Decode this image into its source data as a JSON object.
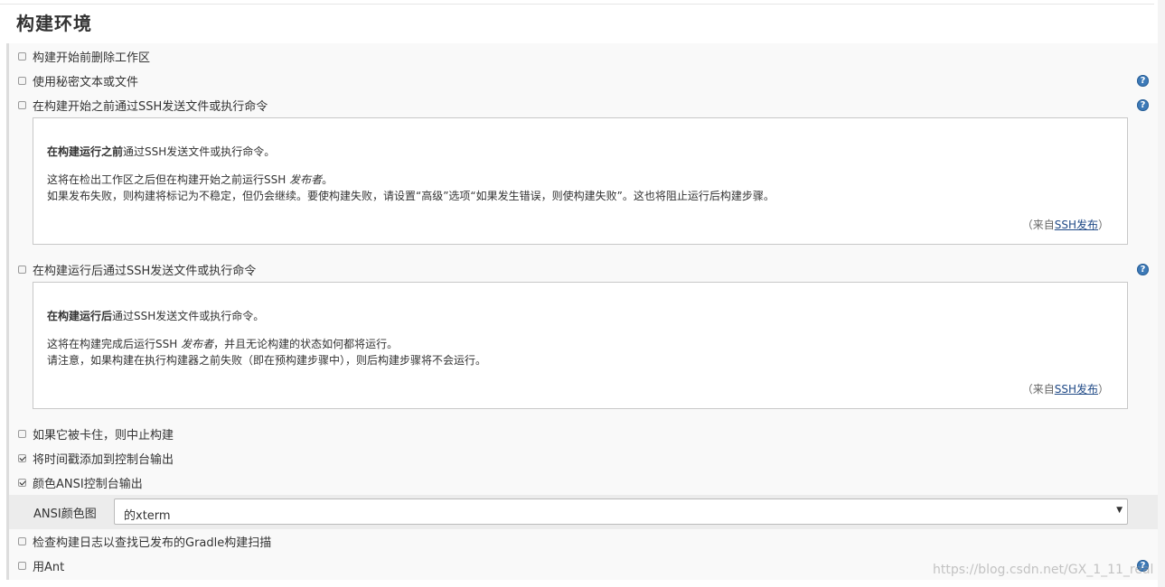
{
  "section": {
    "title": "构建环境"
  },
  "options": {
    "delete_workspace": {
      "label": "构建开始前删除工作区",
      "checked": false
    },
    "secret_text": {
      "label": "使用秘密文本或文件",
      "checked": false
    },
    "ssh_before": {
      "label": "在构建开始之前通过SSH发送文件或执行命令",
      "checked": false
    },
    "ssh_after": {
      "label": "在构建运行后通过SSH发送文件或执行命令",
      "checked": false
    },
    "abort_stuck": {
      "label": "如果它被卡住，则中止构建",
      "checked": false
    },
    "timestamps": {
      "label": "将时间戳添加到控制台输出",
      "checked": true
    },
    "ansi_color": {
      "label": "颜色ANSI控制台输出",
      "checked": true
    },
    "gradle_scan": {
      "label": "检查构建日志以查找已发布的Gradle构建扫描",
      "checked": false
    },
    "use_ant": {
      "label": "用Ant",
      "checked": false
    }
  },
  "help_before": {
    "title_bold": "在构建运行之前",
    "title_rest": "通过SSH发送文件或执行命令。",
    "line1_a": "这将在检出工作区之后但在构建开始之前运行SSH ",
    "line1_em": "发布者",
    "line1_b": "。",
    "line2": "如果发布失败，则构建将标记为不稳定，但仍会继续。要使构建失败，请设置“高级”选项“如果发生错误，则使构建失败”。这也将阻止运行后构建步骤。",
    "from_prefix": "（来自",
    "from_link": "SSH发布",
    "from_suffix": "）"
  },
  "help_after": {
    "title_bold": "在构建运行后",
    "title_rest": "通过SSH发送文件或执行命令。",
    "line1_a": "这将在构建完成后运行SSH ",
    "line1_em": "发布者",
    "line1_b": "，并且无论构建的状态如何都将运行。",
    "line2": "请注意，如果构建在执行构建器之前失败（即在预构建步骤中），则后构建步骤将不会运行。",
    "from_prefix": "（来自",
    "from_link": "SSH发布",
    "from_suffix": "）"
  },
  "ansi": {
    "label": "ANSI颜色图",
    "selected": "的xterm"
  },
  "help_icon_glyph": "?",
  "select_arrow_glyph": "▼",
  "watermark": "https://blog.csdn.net/GX_1_11_real",
  "colors": {
    "help_icon": "#3d7ab8",
    "link": "#204a87",
    "panel_bg": "#f9f9f9",
    "select_row_bg": "#ececec"
  }
}
